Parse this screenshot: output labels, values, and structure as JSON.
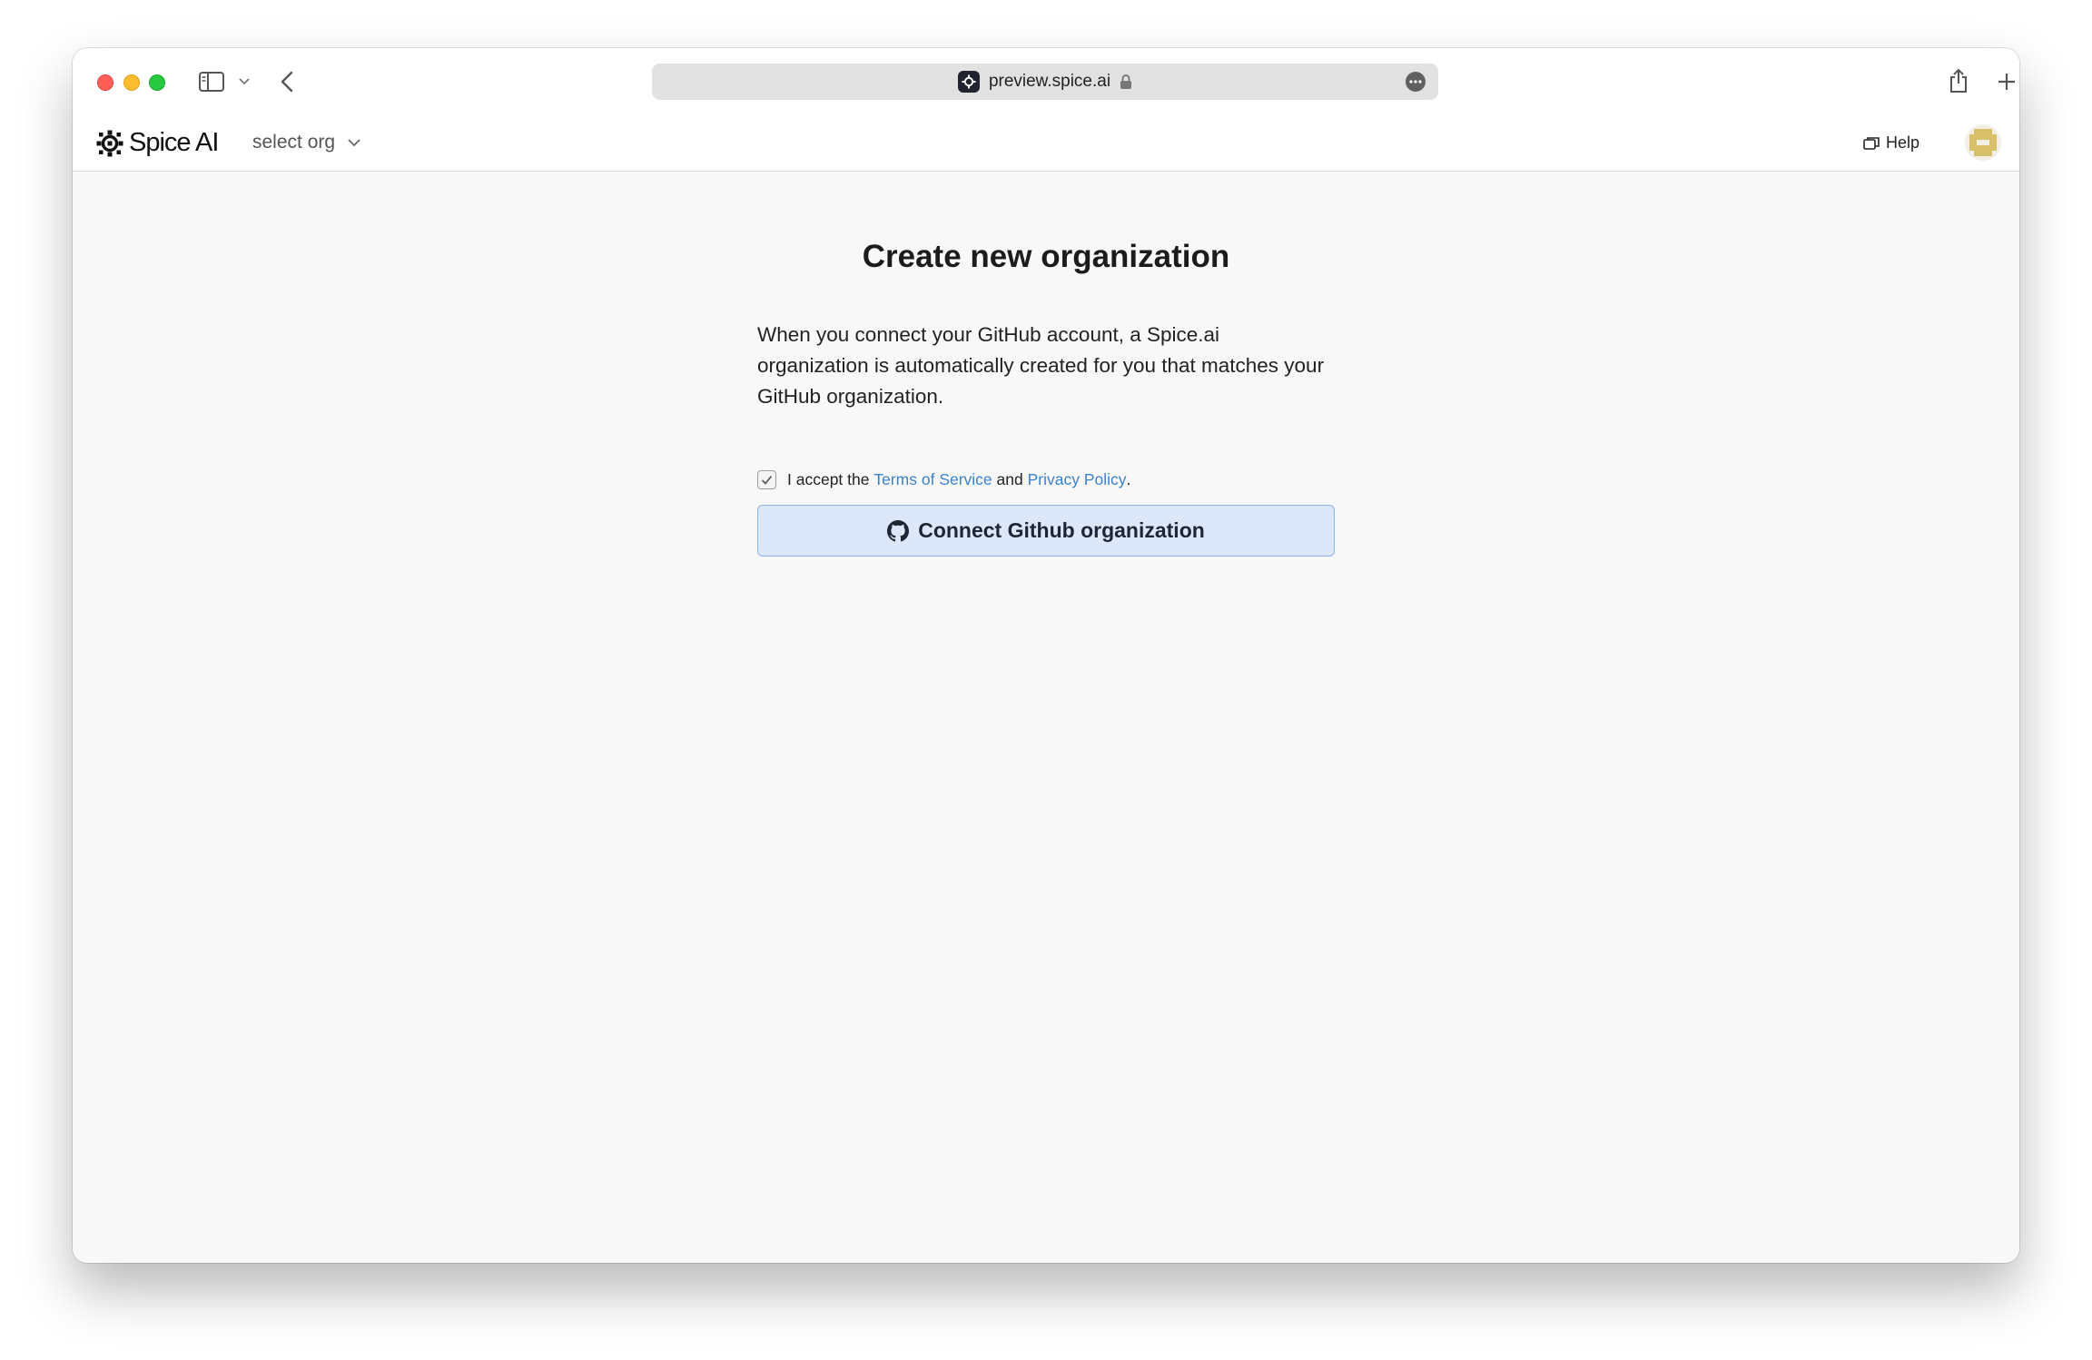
{
  "browser": {
    "url": "preview.spice.ai"
  },
  "header": {
    "brand": "Spice AI",
    "org_select": "select org",
    "help": "Help"
  },
  "main": {
    "title": "Create new organization",
    "description": "When you connect your GitHub account, a Spice.ai organization is automatically created for you that matches your GitHub organization.",
    "accept_prefix": "I accept the",
    "terms_link": "Terms of Service",
    "accept_and": "and",
    "privacy_link": "Privacy Policy",
    "accept_suffix": ".",
    "accept_checked": true,
    "connect_button": "Connect Github organization"
  },
  "colors": {
    "link": "#3b82c9",
    "button_bg": "#dce8fa",
    "button_border": "#8fb0e3"
  }
}
